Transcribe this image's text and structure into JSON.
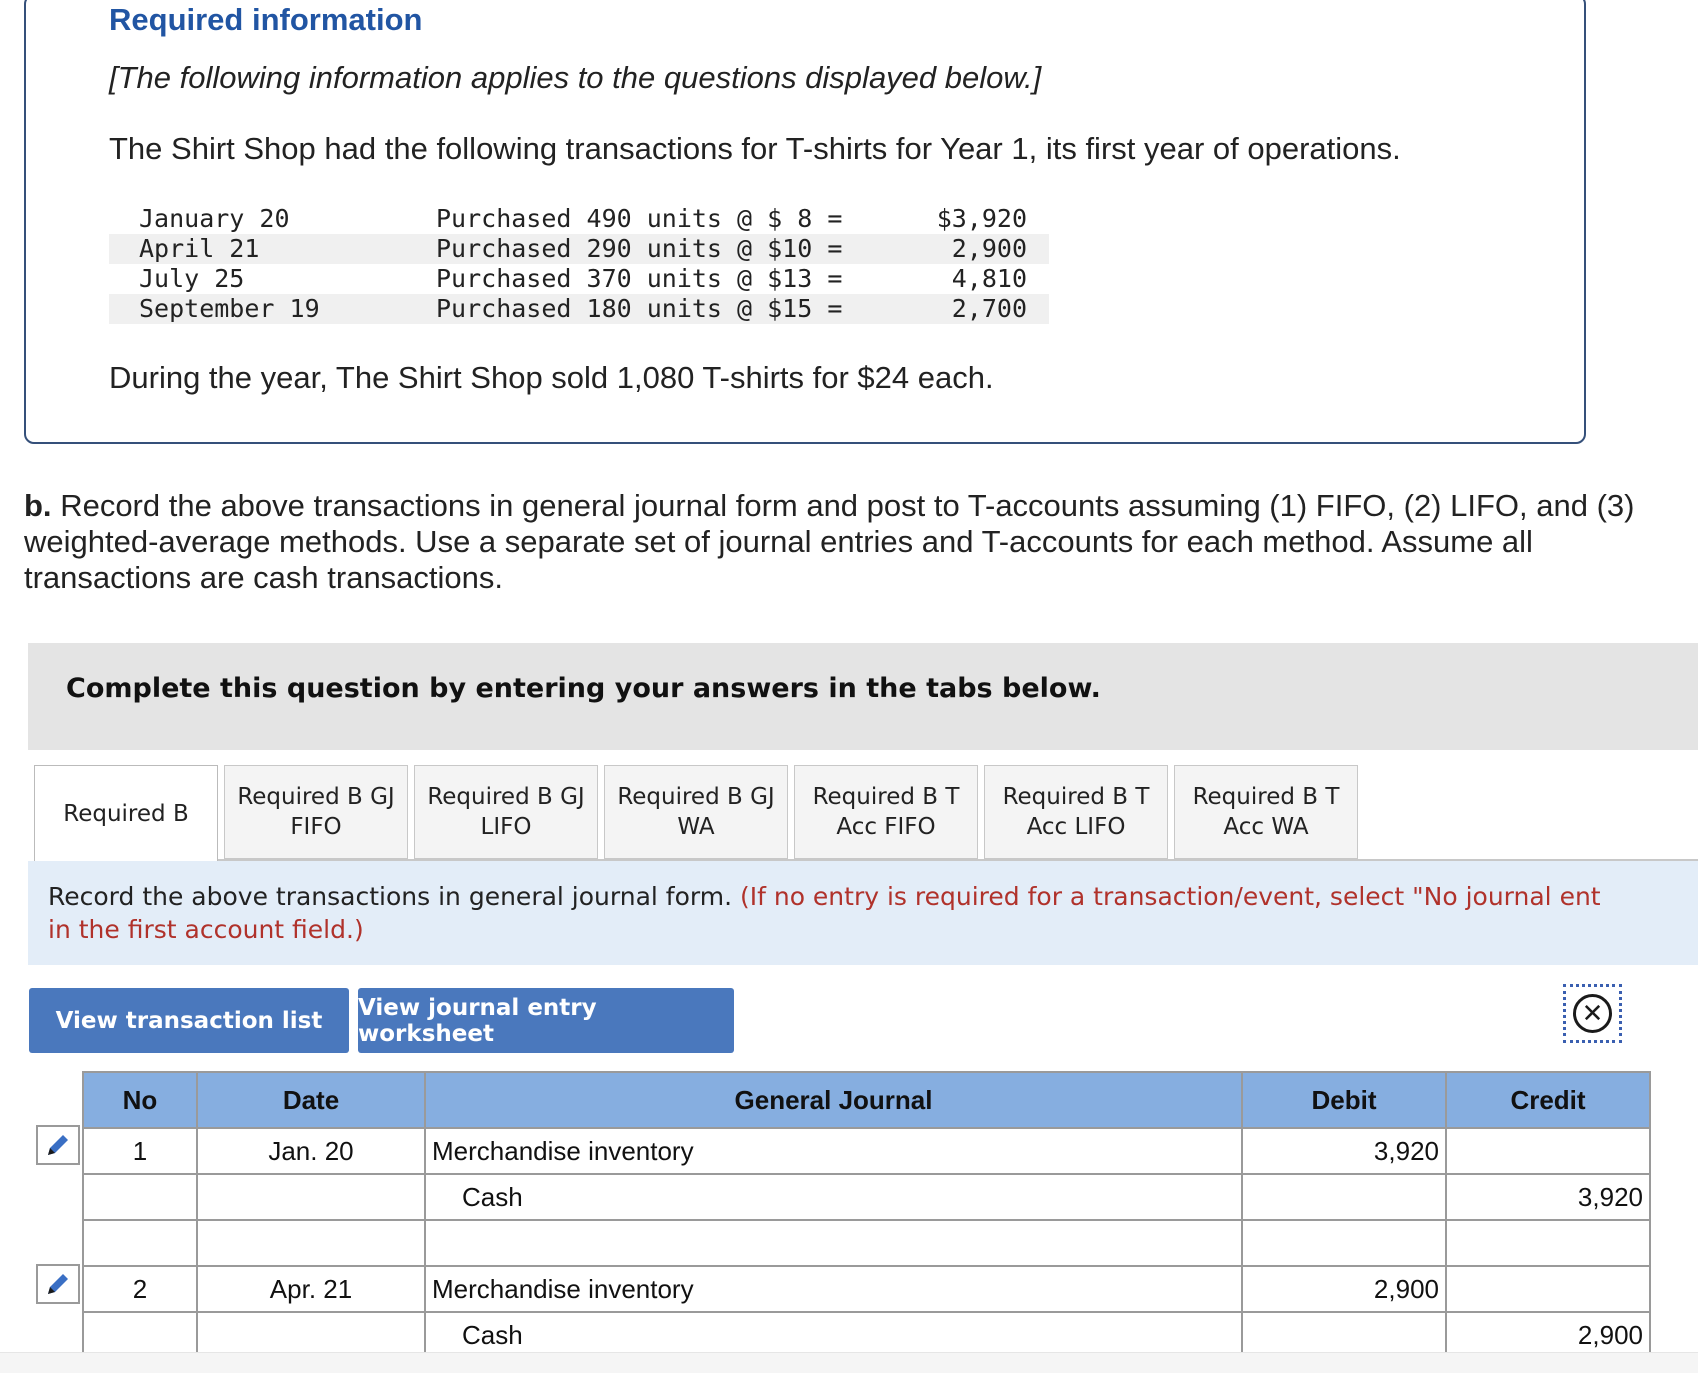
{
  "required_info": {
    "title": "Required information",
    "italic_note": "[The following information applies to the questions displayed below.]",
    "intro": "The Shirt Shop had the following transactions for T-shirts for Year 1, its first year of operations.",
    "transactions": [
      {
        "date": "January 20",
        "desc": "Purchased 490 units @ $ 8 =",
        "amount": "$3,920"
      },
      {
        "date": "April 21",
        "desc": "Purchased 290 units @ $10 =",
        "amount": "2,900"
      },
      {
        "date": "July 25",
        "desc": "Purchased 370 units @ $13 =",
        "amount": "4,810"
      },
      {
        "date": "September 19",
        "desc": "Purchased 180 units @ $15 =",
        "amount": "2,700"
      }
    ],
    "sales_note": "During the year, The Shirt Shop sold 1,080 T-shirts for $24 each."
  },
  "question": {
    "label": "b.",
    "text": "Record the above transactions in general journal form and post to T-accounts assuming (1) FIFO, (2) LIFO, and (3) weighted-average methods. Use a separate set of journal entries and T-accounts for each method. Assume all transactions are cash transactions."
  },
  "complete_banner": "Complete this question by entering your answers in the tabs below.",
  "tabs": [
    {
      "line1": "Required B",
      "line2": ""
    },
    {
      "line1": "Required B GJ",
      "line2": "FIFO"
    },
    {
      "line1": "Required B GJ",
      "line2": "LIFO"
    },
    {
      "line1": "Required B GJ",
      "line2": "WA"
    },
    {
      "line1": "Required B T",
      "line2": "Acc FIFO"
    },
    {
      "line1": "Required B T",
      "line2": "Acc LIFO"
    },
    {
      "line1": "Required B T",
      "line2": "Acc WA"
    }
  ],
  "instructions": {
    "main": "Record the above transactions in general journal form. ",
    "red_part1": "(If no entry is required for a transaction/event, select \"No journal ent",
    "red_part2": "in the first account field.)"
  },
  "buttons": {
    "view_transactions": "View transaction list",
    "view_worksheet": "View journal entry worksheet"
  },
  "journal": {
    "headers": {
      "no": "No",
      "date": "Date",
      "general_journal": "General Journal",
      "debit": "Debit",
      "credit": "Credit"
    },
    "rows": [
      {
        "no": "1",
        "date": "Jan. 20",
        "account": "Merchandise inventory",
        "debit": "3,920",
        "credit": ""
      },
      {
        "no": "",
        "date": "",
        "account": "Cash",
        "debit": "",
        "credit": "3,920"
      },
      {
        "no": "",
        "date": "",
        "account": "",
        "debit": "",
        "credit": ""
      },
      {
        "no": "2",
        "date": "Apr. 21",
        "account": "Merchandise inventory",
        "debit": "2,900",
        "credit": ""
      },
      {
        "no": "",
        "date": "",
        "account": "Cash",
        "debit": "",
        "credit": "2,900"
      }
    ]
  },
  "colors": {
    "title_blue": "#2155a3",
    "button_blue": "#4a78bd",
    "header_blue": "#86aee0",
    "instruction_bg": "#e3edf8",
    "instruction_red": "#b0322b"
  },
  "icons": [
    "pencil-icon",
    "close-icon"
  ]
}
